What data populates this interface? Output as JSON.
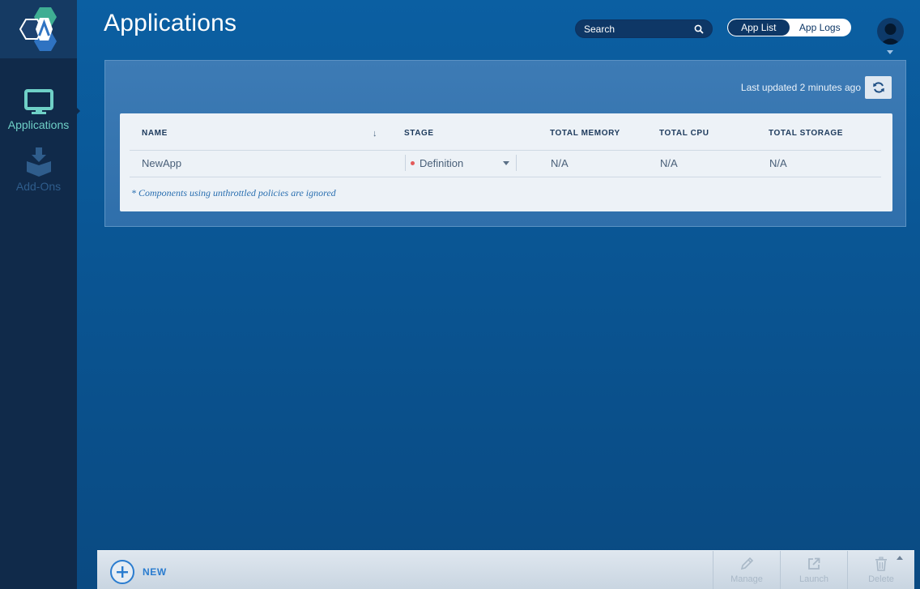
{
  "sidebar": {
    "items": [
      {
        "label": "Applications",
        "icon": "monitor-icon",
        "active": true
      },
      {
        "label": "Add-Ons",
        "icon": "box-download-icon",
        "active": false
      }
    ]
  },
  "header": {
    "title": "Applications",
    "search_placeholder": "Search",
    "toggle": {
      "active": "App List",
      "inactive": "App Logs"
    }
  },
  "panel": {
    "last_updated": "Last updated 2 minutes ago",
    "table": {
      "columns": [
        "NAME",
        "STAGE",
        "TOTAL MEMORY",
        "TOTAL CPU",
        "TOTAL STORAGE"
      ],
      "sort_indicator": "↓",
      "rows": [
        {
          "name": "NewApp",
          "stage": "Definition",
          "memory": "N/A",
          "cpu": "N/A",
          "storage": "N/A"
        }
      ]
    },
    "footnote": "* Components using unthrottled policies are ignored"
  },
  "toolbar": {
    "new_label": "NEW",
    "manage_label": "Manage",
    "launch_label": "Launch",
    "delete_label": "Delete"
  },
  "colors": {
    "accent": "#2a7ccf",
    "sidebar_active": "#6fd0c7",
    "stage_dot": "#e35b5b",
    "background": "#0a5593"
  }
}
